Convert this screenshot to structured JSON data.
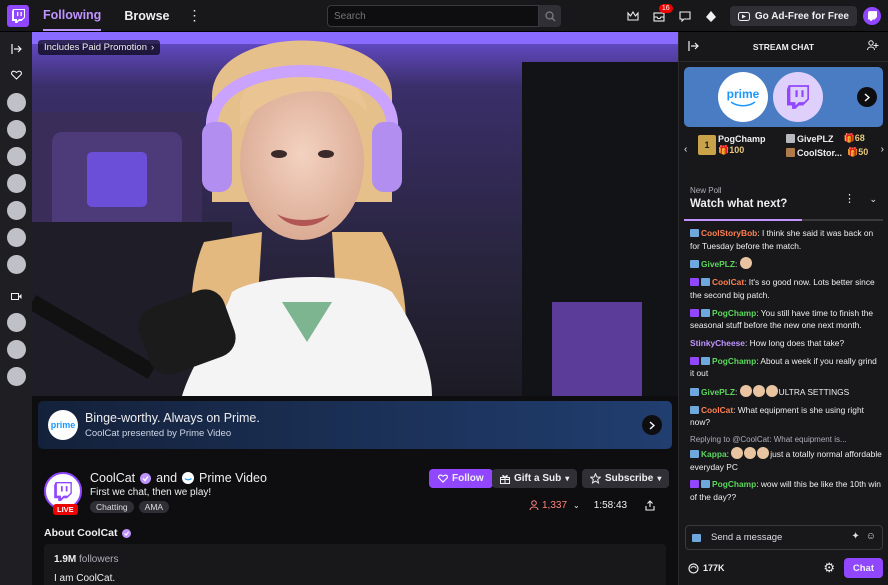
{
  "nav": {
    "following": "Following",
    "browse": "Browse"
  },
  "search": {
    "placeholder": "Search"
  },
  "topbar": {
    "inbox_count": "16",
    "ad_free_label": "Go Ad-Free for Free"
  },
  "player": {
    "promo_label": "Includes Paid Promotion"
  },
  "prime_banner": {
    "title": "Binge-worthy. Always on Prime.",
    "subtitle": "CoolCat presented by Prime Video",
    "logo_text": "prime"
  },
  "channel": {
    "name": "CoolCat",
    "and": "and",
    "partner": "Prime Video",
    "title": "First we chat, then we play!",
    "tags": [
      "Chatting",
      "AMA"
    ],
    "live": "LIVE",
    "viewers": "1,337",
    "uptime": "1:58:43",
    "follow": "Follow",
    "gift": "Gift a Sub",
    "subscribe": "Subscribe"
  },
  "about": {
    "heading": "About CoolCat",
    "followers_count": "1.9M",
    "followers_label": "followers",
    "bio": "I am CoolCat."
  },
  "chat": {
    "header": "STREAM CHAT",
    "prime_word": "prime",
    "gifters": [
      {
        "name": "PogChamp",
        "amount": "100"
      },
      {
        "name": "GivePLZ",
        "amount": "68"
      },
      {
        "name": "CoolStor...",
        "amount": "50"
      }
    ],
    "poll": {
      "label": "New Poll",
      "title": "Watch what next?"
    },
    "input_placeholder": "Send a message",
    "points": "177K",
    "send": "Chat"
  },
  "messages": [
    {
      "user": "CoolStoryBob",
      "color": "#ff7f50",
      "badges": [
        "mod"
      ],
      "text": "I think she said it was back on for Tuesday before the match."
    },
    {
      "user": "GivePLZ",
      "color": "#5cd65c",
      "badges": [
        "mod"
      ],
      "text": "",
      "emotes": 1
    },
    {
      "user": "CoolCat",
      "color": "#ff7f50",
      "badges": [
        "sub",
        "mod"
      ],
      "text": "It's so good now. Lots better since the second big patch."
    },
    {
      "user": "PogChamp",
      "color": "#5cd65c",
      "badges": [
        "sub",
        "mod"
      ],
      "text": "You still have time to finish the seasonal stuff before the new one next month."
    },
    {
      "user": "StinkyCheese",
      "color": "#bf94ff",
      "badges": [],
      "text": "How long does that take?"
    },
    {
      "user": "PogChamp",
      "color": "#5cd65c",
      "badges": [
        "sub",
        "mod"
      ],
      "text": "About a week if you really grind it out"
    },
    {
      "user": "GivePLZ",
      "color": "#5cd65c",
      "badges": [
        "mod"
      ],
      "text": "ULTRA SETTINGS",
      "emotes": 3
    },
    {
      "user": "CoolCat",
      "color": "#ff7f50",
      "badges": [
        "mod"
      ],
      "text": "What equipment is she using right now?"
    },
    {
      "reply": "Replying to @CoolCat: What equipment is...",
      "user": "Kappa",
      "color": "#5cd65c",
      "badges": [
        "mod"
      ],
      "text": "just a totally normal affordable everyday PC",
      "emotes": 3
    },
    {
      "user": "PogChamp",
      "color": "#5cd65c",
      "badges": [
        "sub",
        "mod"
      ],
      "text": "wow will this be like the 10th win of the day??"
    }
  ]
}
